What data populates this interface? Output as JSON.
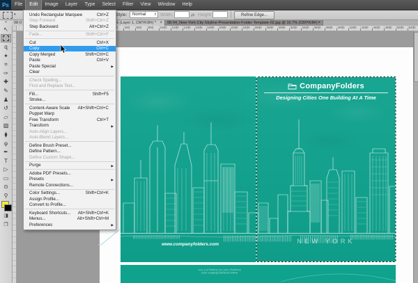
{
  "menubar": {
    "logo": "Ps",
    "items": [
      {
        "label": "File"
      },
      {
        "label": "Edit",
        "active": true
      },
      {
        "label": "Image"
      },
      {
        "label": "Layer"
      },
      {
        "label": "Type"
      },
      {
        "label": "Select"
      },
      {
        "label": "Filter"
      },
      {
        "label": "View"
      },
      {
        "label": "Window"
      },
      {
        "label": "Help"
      }
    ]
  },
  "options_bar": {
    "preset_arrow": "▾",
    "style_label": "Style:",
    "style_value": "Normal",
    "stepper_glyph": "⇕",
    "width_label": "Width:",
    "width_value": "",
    "link_glyph": "⇄",
    "height_label": "Height:",
    "height_value": "",
    "refine_edge_label": "Refine Edge..."
  },
  "tabs": [
    {
      "prefix": "08-0",
      "suffix": "jpg @ 16.7% (Layer 1, CMYK/8#) *",
      "close": "×",
      "active": false
    },
    {
      "label": "08-04_New-York-City-Skyline-Presentation-Folder-Template-02.jpg @ 16.7% (CMYK/8#)",
      "close": "×",
      "active": true
    }
  ],
  "edit_menu": {
    "items": [
      {
        "label": "Undo Rectangular Marquee",
        "shortcut": "Ctrl+Z"
      },
      {
        "label": "Step Forward",
        "shortcut": "Shift+Ctrl+Z",
        "disabled": true
      },
      {
        "label": "Step Backward",
        "shortcut": "Alt+Ctrl+Z",
        "separator_after": true
      },
      {
        "label": "Fade...",
        "shortcut": "Shift+Ctrl+F",
        "disabled": true,
        "separator_after": true
      },
      {
        "label": "Cut",
        "shortcut": "Ctrl+X"
      },
      {
        "label": "Copy",
        "shortcut": "Ctrl+C",
        "highlighted": true
      },
      {
        "label": "Copy Merged",
        "shortcut": "Shift+Ctrl+C"
      },
      {
        "label": "Paste",
        "shortcut": "Ctrl+V"
      },
      {
        "label": "Paste Special",
        "submenu": true
      },
      {
        "label": "Clear",
        "separator_after": true
      },
      {
        "label": "Check Spelling...",
        "disabled": true
      },
      {
        "label": "Find and Replace Text...",
        "disabled": true,
        "separator_after": true
      },
      {
        "label": "Fill...",
        "shortcut": "Shift+F5"
      },
      {
        "label": "Stroke...",
        "separator_after": true
      },
      {
        "label": "Content-Aware Scale",
        "shortcut": "Alt+Shift+Ctrl+C"
      },
      {
        "label": "Puppet Warp"
      },
      {
        "label": "Free Transform",
        "shortcut": "Ctrl+T"
      },
      {
        "label": "Transform",
        "submenu": true
      },
      {
        "label": "Auto-Align Layers...",
        "disabled": true
      },
      {
        "label": "Auto-Blend Layers...",
        "disabled": true,
        "separator_after": true
      },
      {
        "label": "Define Brush Preset..."
      },
      {
        "label": "Define Pattern..."
      },
      {
        "label": "Define Custom Shape...",
        "disabled": true,
        "separator_after": true
      },
      {
        "label": "Purge",
        "submenu": true,
        "separator_after": true
      },
      {
        "label": "Adobe PDF Presets..."
      },
      {
        "label": "Presets",
        "submenu": true
      },
      {
        "label": "Remote Connections...",
        "separator_after": true
      },
      {
        "label": "Color Settings...",
        "shortcut": "Shift+Ctrl+K"
      },
      {
        "label": "Assign Profile..."
      },
      {
        "label": "Convert to Profile...",
        "separator_after": true
      },
      {
        "label": "Keyboard Shortcuts...",
        "shortcut": "Alt+Shift+Ctrl+K"
      },
      {
        "label": "Menus...",
        "shortcut": "Alt+Shift+Ctrl+M"
      },
      {
        "label": "Preferences",
        "submenu": true
      }
    ]
  },
  "toolbar": {
    "collapse_glyph": "»",
    "tools": [
      {
        "name": "move-tool",
        "glyph": "↖"
      },
      {
        "name": "rectangular-marquee-tool",
        "glyph": "",
        "selected": true
      },
      {
        "name": "lasso-tool",
        "glyph": "ɋ"
      },
      {
        "name": "quick-selection-tool",
        "glyph": "✦"
      },
      {
        "name": "crop-tool",
        "glyph": "⌗"
      },
      {
        "name": "eyedropper-tool",
        "glyph": "✑"
      },
      {
        "name": "healing-brush-tool",
        "glyph": "✚"
      },
      {
        "name": "brush-tool",
        "glyph": "✎"
      },
      {
        "name": "clone-stamp-tool",
        "glyph": "♟"
      },
      {
        "name": "history-brush-tool",
        "glyph": "↺"
      },
      {
        "name": "eraser-tool",
        "glyph": "▱"
      },
      {
        "name": "gradient-tool",
        "glyph": "▨"
      },
      {
        "name": "blur-tool",
        "glyph": "⧫"
      },
      {
        "name": "dodge-tool",
        "glyph": "φ"
      },
      {
        "name": "pen-tool",
        "glyph": "✒"
      },
      {
        "name": "type-tool",
        "glyph": "T"
      },
      {
        "name": "path-selection-tool",
        "glyph": "▷"
      },
      {
        "name": "shape-tool",
        "glyph": "▭"
      },
      {
        "name": "hand-tool",
        "glyph": "⊙"
      },
      {
        "name": "zoom-tool",
        "glyph": "⚲"
      }
    ],
    "foreground_color": "#f2e83b",
    "background_color": "#000000",
    "quick_mask_glyph": "◨",
    "screen_mode_glyph": "❐"
  },
  "ruler": {
    "h_labels": [
      200,
      400,
      600,
      800,
      1000,
      1200,
      1400,
      1600,
      1800,
      2000,
      2200,
      2400,
      2600,
      2800,
      3000,
      3200,
      3400,
      3600,
      3800,
      4000,
      4200,
      4400,
      4600,
      4800,
      5000,
      5200
    ]
  },
  "document": {
    "brand_name": "CompanyFolders",
    "tagline": "Designing Cities One Building At A Time",
    "website": "www.companyfolders.com",
    "city": "NEW YORK"
  },
  "colors": {
    "teal": "#0FA28D",
    "menu_highlight": "#2F9BEE",
    "foreground_swatch": "#F2E83B"
  }
}
